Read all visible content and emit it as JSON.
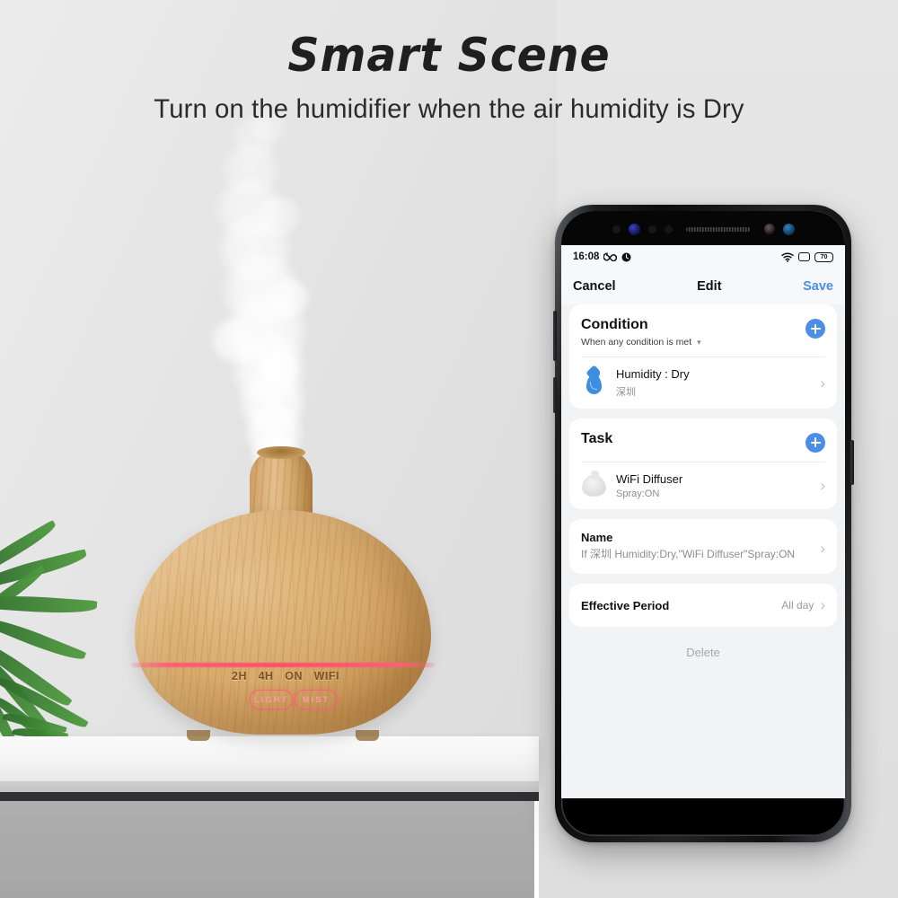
{
  "banner": {
    "title": "Smart Scene",
    "subtitle": "Turn on the humidifier when the air humidity is Dry"
  },
  "product": {
    "timer_labels": [
      "2H",
      "4H",
      "ON",
      "WIFI"
    ],
    "button_light": "LIGHT",
    "button_mist": "MIST",
    "led_color": "#ff4f6e",
    "wood_color": "#d8ab6c"
  },
  "phone": {
    "status_bar": {
      "time": "16:08",
      "left_icons": [
        "infinity-icon",
        "alarm-icon"
      ],
      "right_icons": [
        "wifi-icon",
        "sim-icon"
      ],
      "battery_level": "70"
    },
    "app_bar": {
      "cancel": "Cancel",
      "title": "Edit",
      "save": "Save",
      "save_color": "#4a8ee8"
    },
    "condition_section": {
      "title": "Condition",
      "subtitle": "When any condition is met",
      "add_label": "+",
      "rows": [
        {
          "icon": "water-drop-icon",
          "primary": "Humidity : Dry",
          "secondary": "深圳"
        }
      ]
    },
    "task_section": {
      "title": "Task",
      "add_label": "+",
      "rows": [
        {
          "icon": "diffuser-device-icon",
          "primary": "WiFi Diffuser",
          "secondary": "Spray:ON"
        }
      ]
    },
    "name_section": {
      "label": "Name",
      "value": "If 深圳 Humidity:Dry,\"WiFi Diffuser\"Spray:ON"
    },
    "effective_period": {
      "label": "Effective Period",
      "value": "All day"
    },
    "delete_label": "Delete",
    "nav_bar": {
      "back": "back-icon",
      "home": "home-icon",
      "recents": "recents-icon"
    }
  }
}
